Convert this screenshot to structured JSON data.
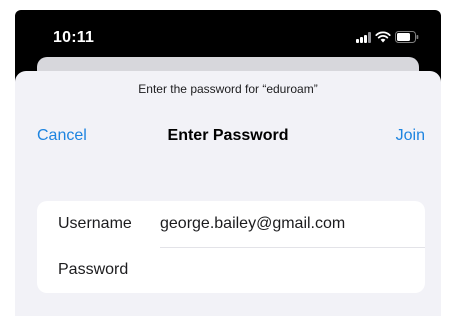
{
  "status_bar": {
    "time": "10:11",
    "icons": [
      "cellular-signal-icon",
      "wifi-icon",
      "battery-icon"
    ]
  },
  "sheet": {
    "prompt": "Enter the password for “eduroam”",
    "nav": {
      "cancel_label": "Cancel",
      "title": "Enter Password",
      "join_label": "Join"
    },
    "form": {
      "username": {
        "label": "Username",
        "value": "george.bailey@gmail.com"
      },
      "password": {
        "label": "Password",
        "value": ""
      }
    }
  },
  "colors": {
    "accent": "#1d84e0",
    "sheet_background": "#f2f2f7",
    "status_bar_background": "#000000"
  }
}
